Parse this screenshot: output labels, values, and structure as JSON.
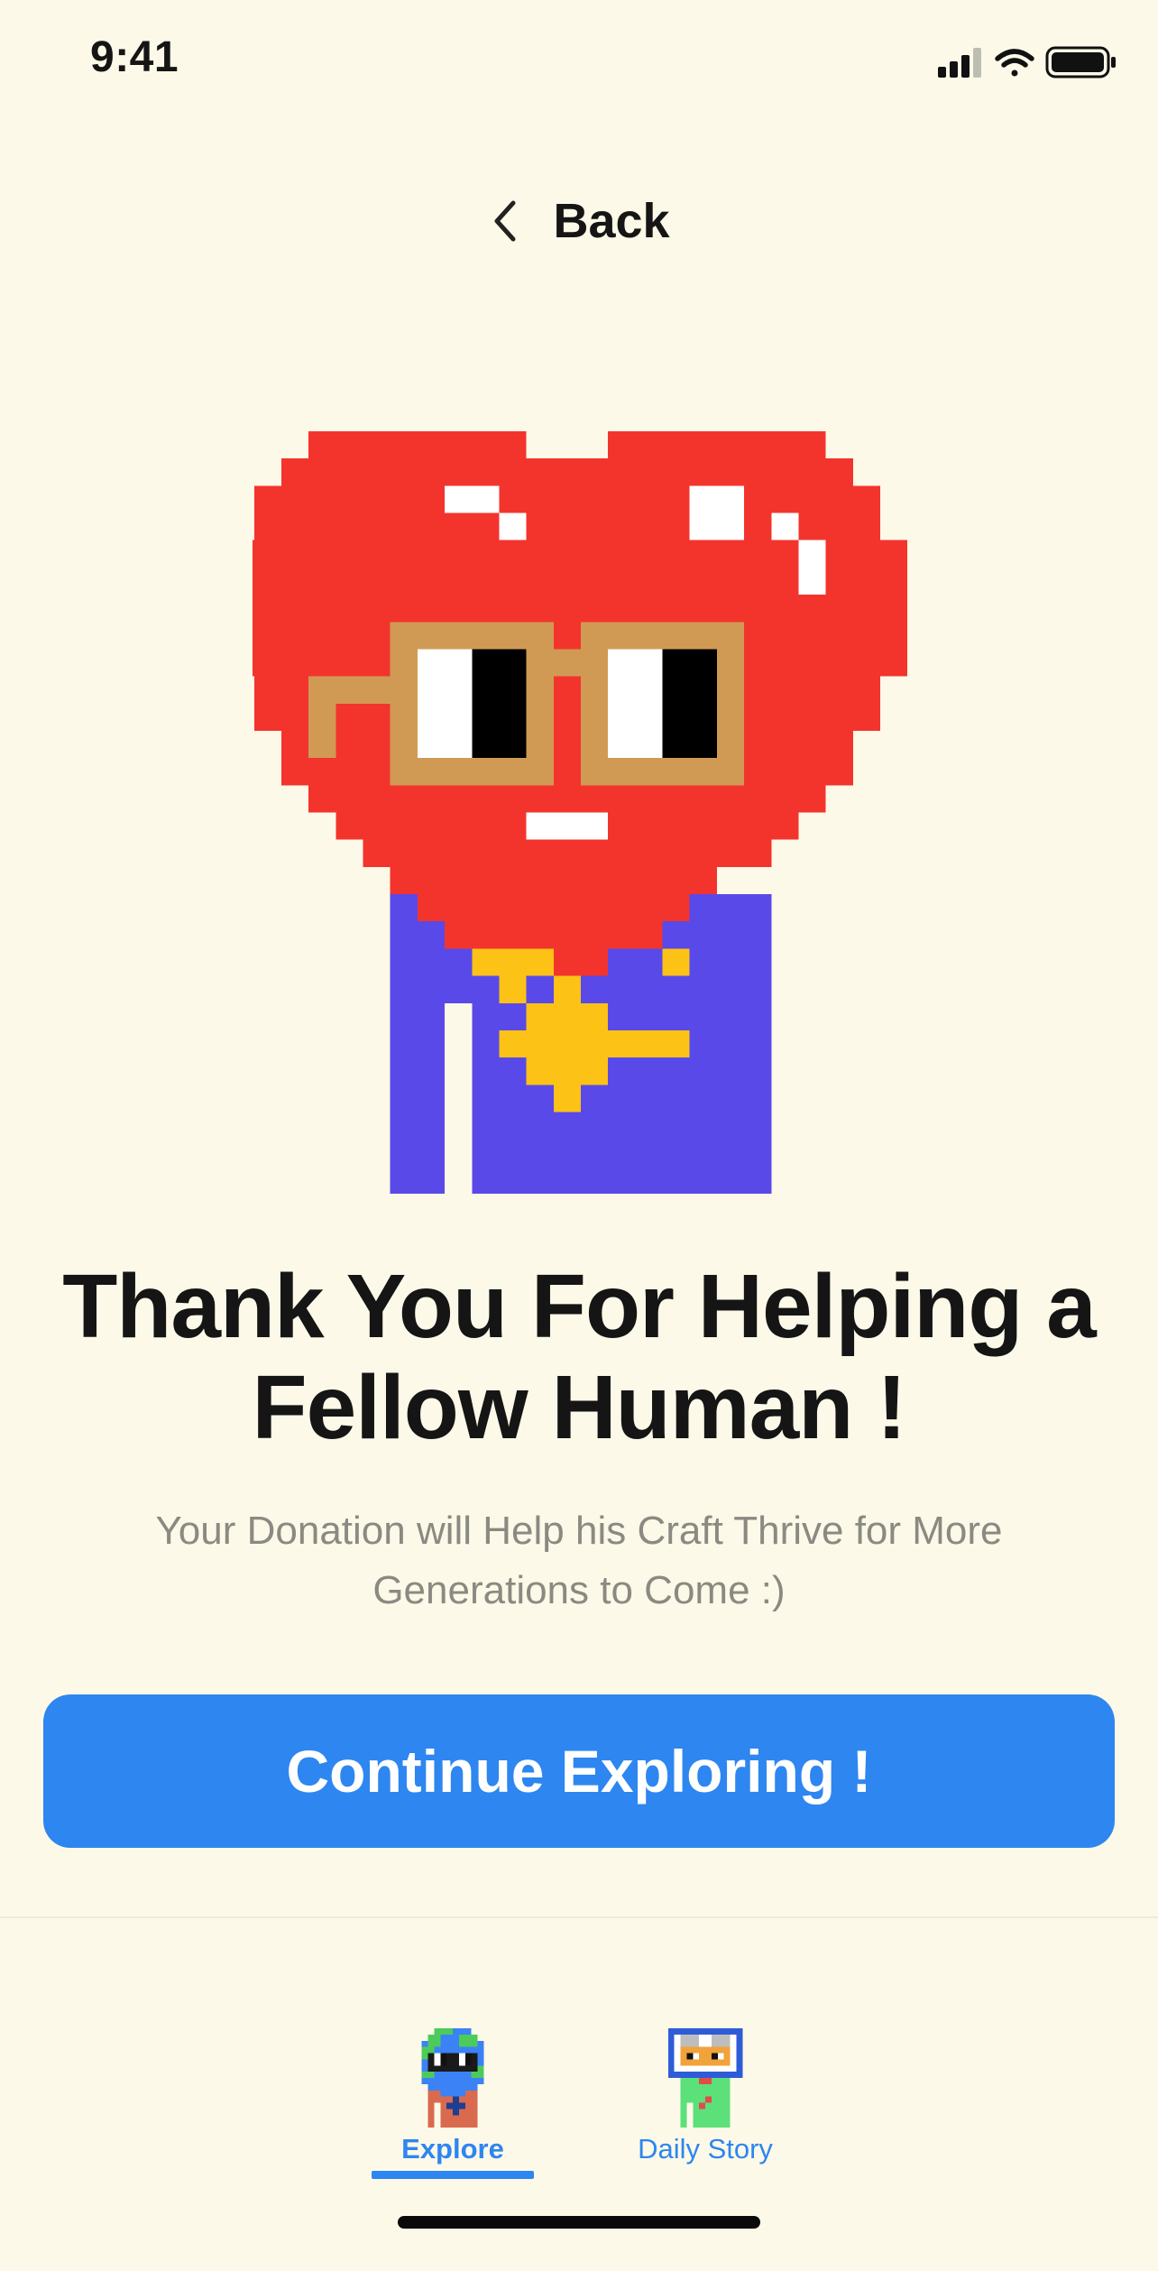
{
  "status_bar": {
    "time": "9:41"
  },
  "header": {
    "back_label": "Back",
    "back_icon": "chevron-left-icon"
  },
  "mascot": {
    "icon": "pixel-heart-character-with-glasses",
    "colors": {
      "heart": "#F3342D",
      "glasses": "#D19A54",
      "shirt": "#5949E8",
      "star": "#FCC216"
    }
  },
  "main": {
    "headline_line1": "Thank You For Helping a",
    "headline_line2": "Fellow Human !",
    "subtext_line1": "Your Donation will Help his Craft Thrive for More",
    "subtext_line2": "Generations to Come :)",
    "cta_label": "Continue Exploring !"
  },
  "tab_bar": {
    "tabs": [
      {
        "label": "Explore",
        "icon": "earth-character-icon",
        "active": true
      },
      {
        "label": "Daily Story",
        "icon": "book-reader-character-icon",
        "active": false
      }
    ]
  },
  "colors": {
    "background": "#FDF9E8",
    "accent": "#2E86F0",
    "text": "#151515",
    "muted_text": "#8A8A82"
  }
}
